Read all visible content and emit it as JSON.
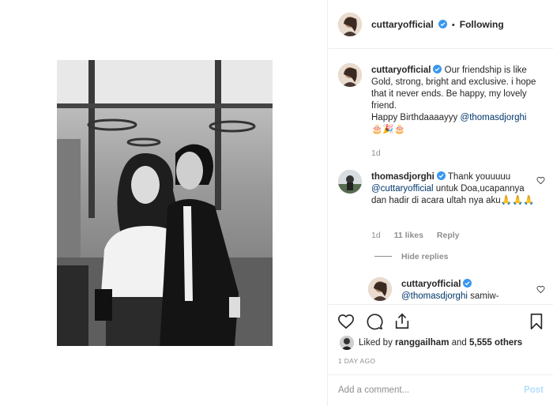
{
  "post": {
    "username": "cuttaryofficial",
    "follow_state": "Following",
    "separator": "•"
  },
  "caption": {
    "username": "cuttaryofficial",
    "text": "Our friendship is like Gold, strong, bright and exclusive. i hope that it never ends. Be happy, my lovely friend.",
    "line2": "Happy Birthdaaaayyy",
    "mention": "@thomasdjorghi",
    "emoji": "🎂🎉🎂",
    "time": "1d"
  },
  "comments": [
    {
      "username": "thomasdjorghi",
      "text_pre": "Thank youuuuu",
      "mention": "@cuttaryofficial",
      "text_post": "untuk Doa,ucapannya dan hadir di acara ultah nya aku",
      "emoji": "🙏🙏🙏",
      "time": "1d",
      "likes": "11 likes",
      "reply": "Reply",
      "hide_replies": "Hide replies"
    }
  ],
  "reply": {
    "username": "cuttaryofficial",
    "mention": "@thomasdjorghi",
    "text": "samiw-"
  },
  "liked_by": {
    "prefix": "Liked by",
    "user": "ranggailham",
    "middle": "and",
    "others": "5,555 others"
  },
  "time_ago": "1 DAY AGO",
  "add_comment": {
    "placeholder": "Add a comment...",
    "post_label": "Post"
  },
  "icons": {
    "like": "heart-icon",
    "comment": "comment-icon",
    "share": "share-icon",
    "save": "bookmark-icon",
    "verified": "verified-badge-icon"
  },
  "colors": {
    "verified": "#3897f0",
    "mention": "#00376b",
    "muted": "#8e8e8e",
    "post_disabled": "#b2dffc"
  }
}
